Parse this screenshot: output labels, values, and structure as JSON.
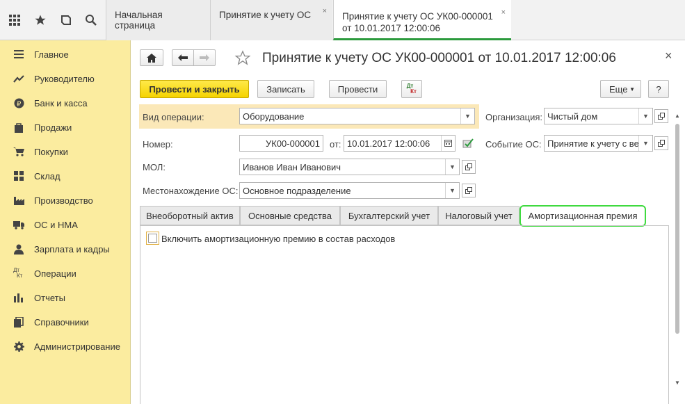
{
  "tabs": [
    {
      "label": "Начальная страница"
    },
    {
      "label": "Принятие к учету ОС",
      "close": "×"
    },
    {
      "line1": "Принятие к учету ОС УК00-000001",
      "line2": "от 10.01.2017 12:00:06",
      "close": "×"
    }
  ],
  "sidebar": {
    "items": [
      {
        "label": "Главное",
        "icon": "menu-lines-icon"
      },
      {
        "label": "Руководителю",
        "icon": "trend-icon"
      },
      {
        "label": "Банк и касса",
        "icon": "ruble-coin-icon"
      },
      {
        "label": "Продажи",
        "icon": "shopping-bag-icon"
      },
      {
        "label": "Покупки",
        "icon": "cart-icon"
      },
      {
        "label": "Склад",
        "icon": "warehouse-icon"
      },
      {
        "label": "Производство",
        "icon": "factory-icon"
      },
      {
        "label": "ОС и НМА",
        "icon": "truck-icon"
      },
      {
        "label": "Зарплата и кадры",
        "icon": "person-icon"
      },
      {
        "label": "Операции",
        "icon": "dt-kt-icon"
      },
      {
        "label": "Отчеты",
        "icon": "bar-chart-icon"
      },
      {
        "label": "Справочники",
        "icon": "books-icon"
      },
      {
        "label": "Администрирование",
        "icon": "gear-icon"
      }
    ]
  },
  "doc": {
    "title": "Принятие к учету ОС УК00-000001 от 10.01.2017 12:00:06",
    "close": "×",
    "toolbar": {
      "post_close": "Провести и закрыть",
      "save": "Записать",
      "post": "Провести",
      "more": "Еще",
      "help": "?",
      "dt": "Дт",
      "kt": "Кт"
    },
    "fields": {
      "operation_type_label": "Вид операции:",
      "operation_type_value": "Оборудование",
      "organization_label": "Организация:",
      "organization_value": "Чистый дом",
      "number_label": "Номер:",
      "number_value": "УК00-000001",
      "date_label": "от:",
      "date_value": "10.01.2017 12:00:06",
      "event_label": "Событие ОС:",
      "event_value": "Принятие к учету с ве",
      "mol_label": "МОЛ:",
      "mol_value": "Иванов Иван Иванович",
      "location_label": "Местонахождение ОС:",
      "location_value": "Основное подразделение"
    },
    "form_tabs": [
      {
        "label": "Внеоборотный актив"
      },
      {
        "label": "Основные средства"
      },
      {
        "label": "Бухгалтерский учет"
      },
      {
        "label": "Налоговый учет"
      },
      {
        "label": "Амортизационная премия"
      }
    ],
    "checkbox_label": "Включить амортизационную премию в состав расходов"
  },
  "colors": {
    "sidebar": "#fbec9f",
    "primary_button": "#f5d300",
    "active_tab_underline": "#2b9a3c",
    "highlight": "#3fda3f"
  }
}
